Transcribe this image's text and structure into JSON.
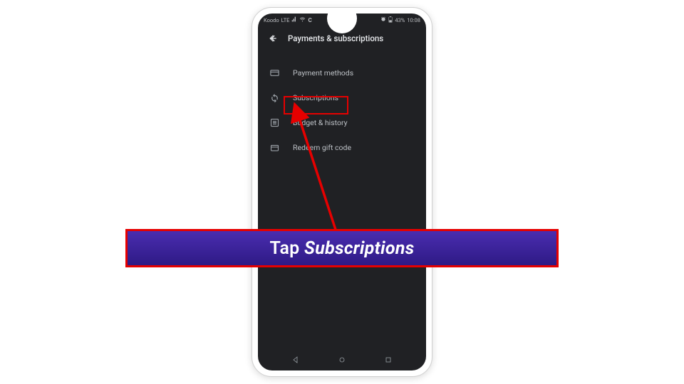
{
  "status_bar": {
    "carrier": "Koodo",
    "lte": "LTE",
    "signal_icons": "▯",
    "alarm": "⏰",
    "battery_text": "43%",
    "time": "10:08"
  },
  "header": {
    "title": "Payments & subscriptions"
  },
  "menu": {
    "items": [
      {
        "icon": "card-icon",
        "label": "Payment methods"
      },
      {
        "icon": "sync-icon",
        "label": "Subscriptions"
      },
      {
        "icon": "list-icon",
        "label": "Budget & history"
      },
      {
        "icon": "gift-icon",
        "label": "Redeem gift code"
      }
    ]
  },
  "callout": {
    "prefix": "Tap ",
    "emphasis": "Subscriptions"
  },
  "colors": {
    "highlight": "#e60000",
    "banner_top": "#4a2db0",
    "banner_bottom": "#2e1a85",
    "screen_bg": "#202124"
  }
}
